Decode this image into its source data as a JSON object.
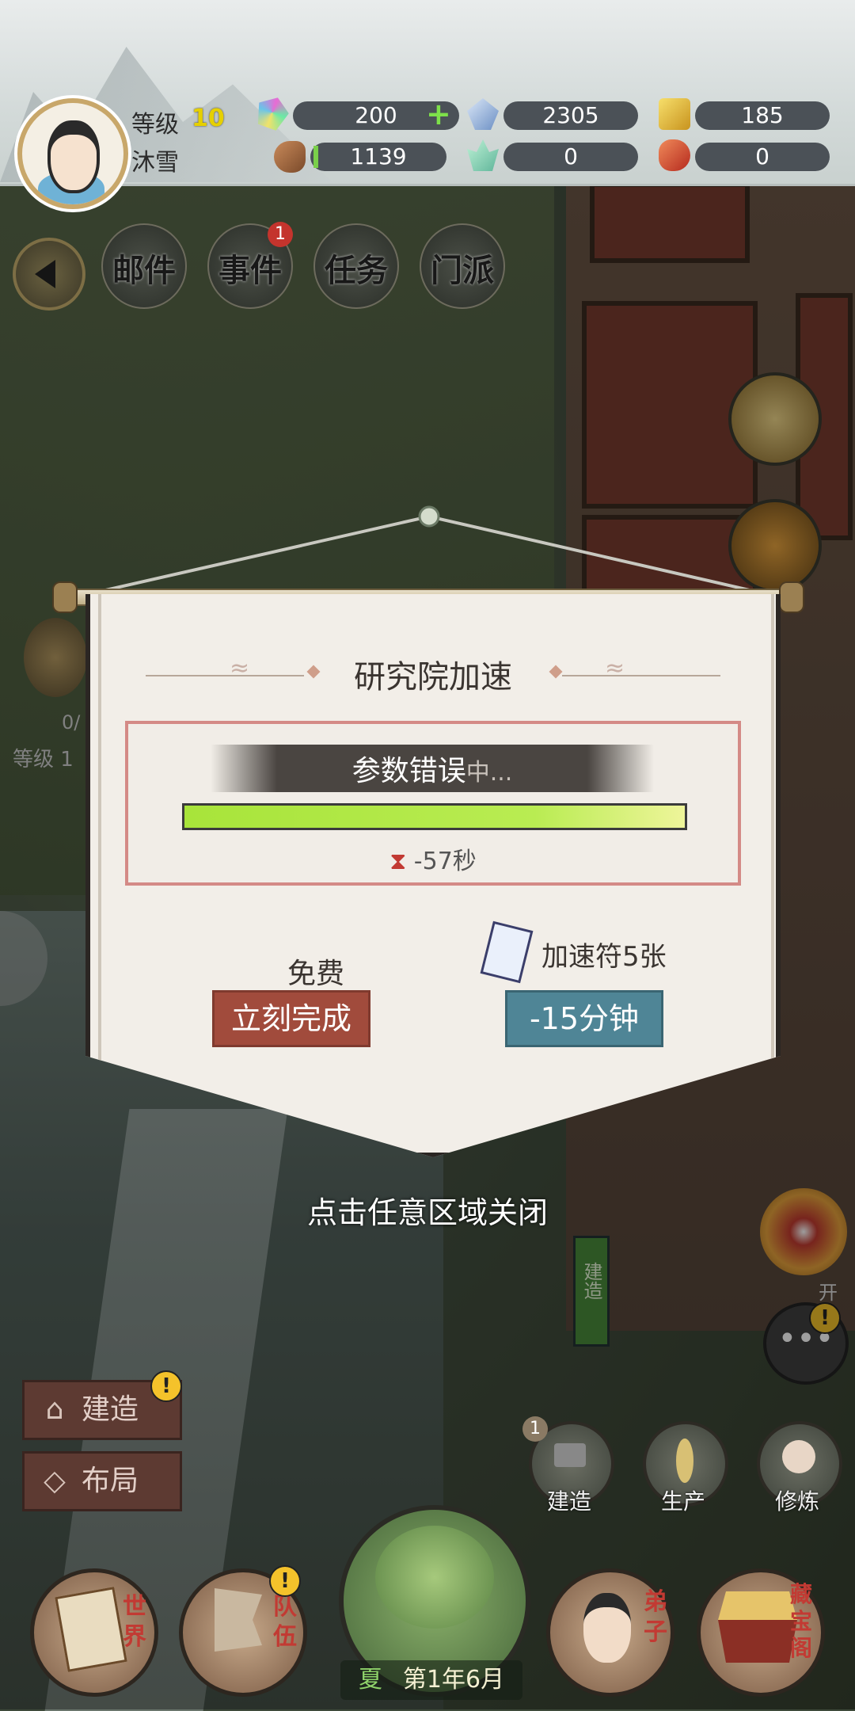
{
  "player": {
    "level_label": "等级",
    "level": "10",
    "name": "沐雪"
  },
  "resources": {
    "spirit_stone": "200",
    "crystal": "2305",
    "gold": "185",
    "wood": "1139",
    "herb": "0",
    "meat": "0"
  },
  "menu": {
    "mail": "邮件",
    "event": "事件",
    "event_badge": "1",
    "task": "任务",
    "sect": "门派"
  },
  "dialog": {
    "title": "研究院加速",
    "status": "参数错误",
    "status_suffix": "中...",
    "progress_percent": 100,
    "timer": "-57秒",
    "free_label": "免费",
    "complete_button": "立刻完成",
    "ticket_label": "加速符5张",
    "speedup_button": "-15分钟",
    "close_hint": "点击任意区域关闭"
  },
  "left_buttons": {
    "build": "建造",
    "layout": "布局"
  },
  "scene_labels": {
    "build_sign": "建造",
    "open_text": "开",
    "level_text": "等级 1",
    "count_text": "0/"
  },
  "right_actions": {
    "build_badge": "1",
    "build": "建造",
    "produce": "生产",
    "cultivate": "修炼"
  },
  "bottom_nav": {
    "world": "世界",
    "team": "队伍",
    "disciple": "弟子",
    "treasury": "藏宝阁",
    "season": "夏",
    "date": "第1年6月"
  },
  "colors": {
    "accent_red": "#a14b3c",
    "accent_teal": "#4f8596",
    "progress_green": "#a8e43a"
  }
}
